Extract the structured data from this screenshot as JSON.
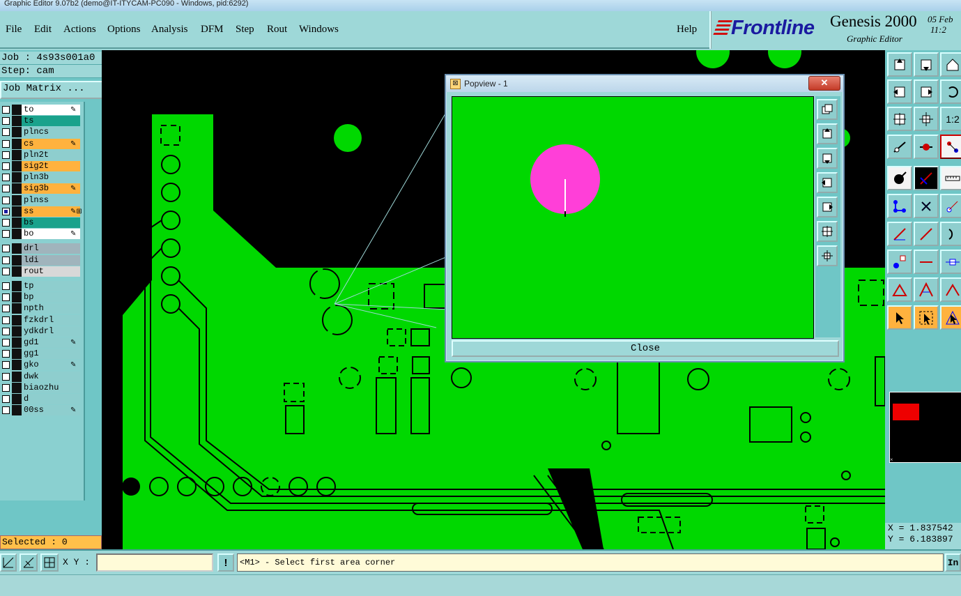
{
  "window": {
    "title": "Graphic Editor 9.07b2 (demo@IT-ITYCAM-PC090 - Windows, pid:6292)"
  },
  "menu": {
    "items": [
      {
        "label": "File",
        "name": "file"
      },
      {
        "label": "Edit",
        "name": "edit"
      },
      {
        "label": "Actions",
        "name": "actions"
      },
      {
        "label": "Options",
        "name": "options"
      },
      {
        "label": "Analysis",
        "name": "analysis"
      },
      {
        "label": "DFM",
        "name": "dfm"
      },
      {
        "label": "Step",
        "name": "step"
      },
      {
        "label": "Rout",
        "name": "rout"
      },
      {
        "label": "Windows",
        "name": "windows"
      }
    ],
    "help": "Help"
  },
  "brand": {
    "logo": "Frontline",
    "title": "Genesis 2000",
    "subtitle": "Graphic Editor",
    "date": "05 Feb",
    "time": "11:2"
  },
  "job": {
    "job_line": "Job : 4s93s001a0",
    "step_line": "Step: cam",
    "matrix_button": "Job Matrix ..."
  },
  "layers": [
    {
      "name": "to",
      "color": "#ffffff",
      "mark": "✎"
    },
    {
      "name": "ts",
      "color": "#1aa28c",
      "mark": ""
    },
    {
      "name": "plncs",
      "color": "#8ecece",
      "mark": ""
    },
    {
      "name": "cs",
      "color": "#ffb23e",
      "mark": "✎"
    },
    {
      "name": "pln2t",
      "color": "#8ecece",
      "mark": ""
    },
    {
      "name": "sig2t",
      "color": "#ffb23e",
      "mark": ""
    },
    {
      "name": "pln3b",
      "color": "#8ecece",
      "mark": ""
    },
    {
      "name": "sig3b",
      "color": "#ffb23e",
      "mark": "✎"
    },
    {
      "name": "plnss",
      "color": "#8ecece",
      "mark": ""
    },
    {
      "name": "ss",
      "color": "#ffb23e",
      "mark": "✎⊞",
      "active": true
    },
    {
      "name": "bs",
      "color": "#1aa28c",
      "mark": ""
    },
    {
      "name": "bo",
      "color": "#ffffff",
      "mark": "✎"
    },
    {
      "name": "drl",
      "color": "#a0b4bc",
      "mark": ""
    },
    {
      "name": "ldi",
      "color": "#a0b4bc",
      "mark": ""
    },
    {
      "name": "rout",
      "color": "#d8d8d8",
      "mark": ""
    },
    {
      "name": "tp",
      "color": "#8ecece",
      "mark": ""
    },
    {
      "name": "bp",
      "color": "#8ecece",
      "mark": ""
    },
    {
      "name": "npth",
      "color": "#8ecece",
      "mark": ""
    },
    {
      "name": "fzkdrl",
      "color": "#8ecece",
      "mark": ""
    },
    {
      "name": "ydkdrl",
      "color": "#8ecece",
      "mark": ""
    },
    {
      "name": "gd1",
      "color": "#8ecece",
      "mark": "✎"
    },
    {
      "name": "gg1",
      "color": "#8ecece",
      "mark": ""
    },
    {
      "name": "gko",
      "color": "#8ecece",
      "mark": "✎"
    },
    {
      "name": "dwk",
      "color": "#8ecece",
      "mark": ""
    },
    {
      "name": "biaozhu",
      "color": "#8ecece",
      "mark": ""
    },
    {
      "name": "d",
      "color": "#8ecece",
      "mark": ""
    },
    {
      "name": "00ss",
      "color": "#8ecece",
      "mark": "✎"
    }
  ],
  "selected": "Selected : 0",
  "popview": {
    "title": "Popview - 1",
    "close_x": "✕",
    "close_button": "Close"
  },
  "coords": {
    "x": "X = 1.837542",
    "y": "Y = 6.183897"
  },
  "bottom": {
    "xy_label": "X Y :",
    "xy_value": "",
    "alert": "!",
    "prompt": "<M1> - Select first area corner",
    "right_button": "In"
  },
  "colors": {
    "copper": "#00d800",
    "background": "#000000",
    "highlight_pad": "#ff3fd8",
    "overview_mark": "#ee0000"
  }
}
